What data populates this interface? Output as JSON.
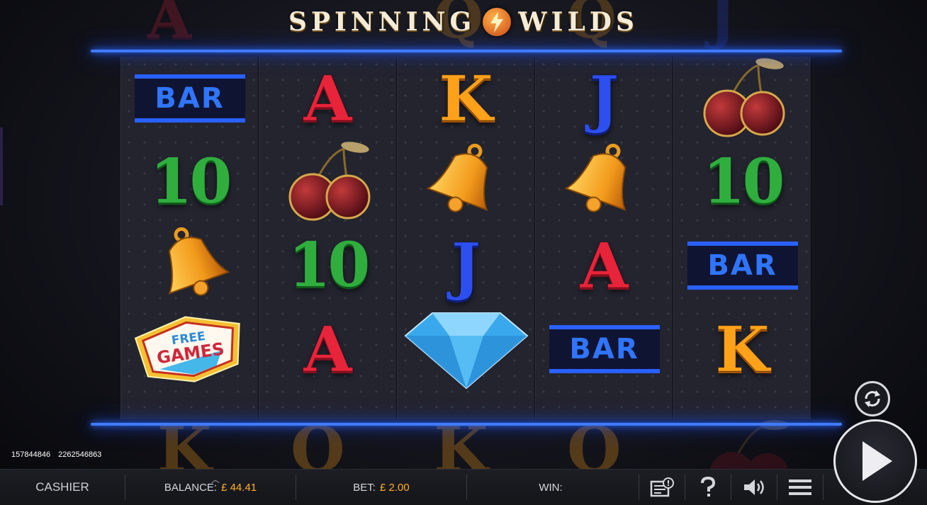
{
  "game": {
    "title_left": "SPINNING",
    "title_right": "WILDS",
    "logo_icon": "lightning-bolt-icon",
    "ghost_top_row": [
      "A",
      "Q",
      "Q",
      "J"
    ],
    "ghost_bottom_row": [
      "K",
      "Q",
      "K",
      "Q",
      "cherry"
    ],
    "reels": [
      [
        "BAR",
        "10",
        "bell",
        "free-games"
      ],
      [
        "A",
        "cherry",
        "10",
        "A"
      ],
      [
        "K",
        "bell",
        "J",
        "diamond"
      ],
      [
        "J",
        "bell",
        "A",
        "BAR"
      ],
      [
        "cherry",
        "10",
        "BAR",
        "K"
      ]
    ],
    "free_games_line1": "FREE",
    "free_games_line2": "GAMES"
  },
  "ids": {
    "left": "157844846",
    "right": "2262546863"
  },
  "bottom_bar": {
    "cashier_label": "CASHIER",
    "balance_label": "BALANCE:",
    "balance_value": "£ 44.41",
    "bet_label": "BET:",
    "bet_value": "£ 2.00",
    "win_label": "WIN:",
    "win_value": "",
    "icons": [
      "paytable-icon",
      "help-icon",
      "sound-icon",
      "menu-icon"
    ]
  },
  "controls": {
    "autoplay_icon": "autoplay-refresh-icon",
    "spin_icon": "play-icon"
  },
  "colors": {
    "accent_neon": "#3f7bff",
    "value_orange": "#ffb02a",
    "letter_a": "#e8243a",
    "letter_k": "#ffa21a",
    "letter_j": "#2d4ff0",
    "ten_green": "#2fae3e"
  }
}
